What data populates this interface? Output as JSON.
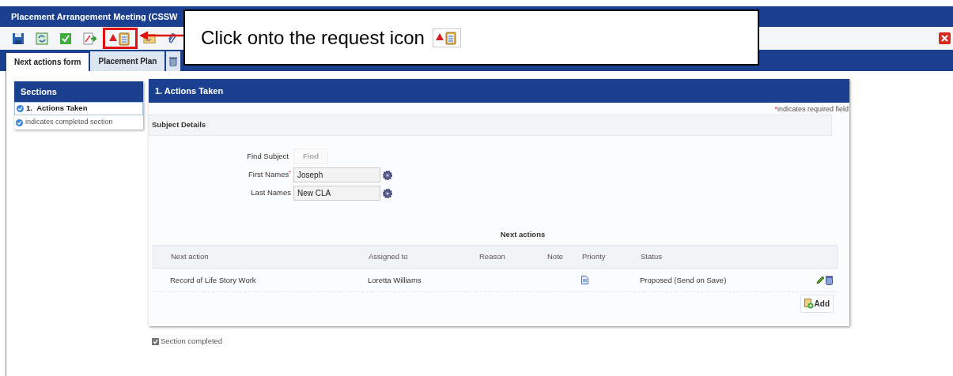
{
  "window": {
    "title": "Placement Arrangement Meeting (CSSW"
  },
  "toolbar": [
    {
      "kind": "save",
      "highlighted": false
    },
    {
      "kind": "refresh",
      "highlighted": false
    },
    {
      "kind": "check",
      "highlighted": false
    },
    {
      "kind": "export",
      "highlighted": false
    },
    {
      "kind": "request",
      "highlighted": true
    },
    {
      "kind": "letter",
      "highlighted": false
    },
    {
      "kind": "attach",
      "highlighted": false
    }
  ],
  "callout": {
    "text": "Click onto the request icon"
  },
  "tabs": [
    {
      "label": "Next actions form",
      "selected": true
    },
    {
      "label": "Placement Plan",
      "selected": false
    }
  ],
  "sections": {
    "title": "Sections",
    "items": [
      {
        "number": "1.",
        "label": "Actions Taken",
        "completed": true,
        "selected": true
      }
    ],
    "legend": "indicates completed section"
  },
  "form": {
    "title": "1. Actions Taken",
    "required_mark": "*",
    "required_note": "indicates required field",
    "subheading": "Subject Details",
    "find_label": "Find Subject",
    "find_button": "Find",
    "fields": [
      {
        "label": "First Names",
        "required": true,
        "value": "Joseph"
      },
      {
        "label": "Last Names",
        "required": false,
        "value": "New CLA"
      }
    ],
    "next_actions": {
      "title": "Next actions",
      "columns": [
        "Next action",
        "Assigned to",
        "Reason",
        "Note",
        "Priority",
        "Status"
      ],
      "rows": [
        {
          "next_action": "Record of Life Story Work",
          "assigned_to": "Loretta Williams",
          "status": "Proposed (Send on Save)"
        }
      ],
      "add_button": "Add"
    },
    "section_completed": {
      "label": "Section completed",
      "checked": true
    }
  }
}
